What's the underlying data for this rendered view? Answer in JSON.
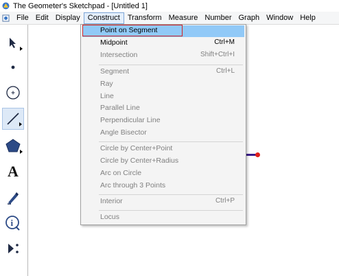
{
  "window": {
    "title": "The Geometer's Sketchpad - [Untitled 1]"
  },
  "menubar": {
    "items": [
      "File",
      "Edit",
      "Display",
      "Construct",
      "Transform",
      "Measure",
      "Number",
      "Graph",
      "Window",
      "Help"
    ],
    "active": "Construct"
  },
  "toolbar": {
    "tools": [
      {
        "name": "arrow-tool-icon"
      },
      {
        "name": "point-tool-icon"
      },
      {
        "name": "compass-tool-icon"
      },
      {
        "name": "straightedge-tool-icon",
        "selected": true
      },
      {
        "name": "polygon-tool-icon"
      },
      {
        "name": "text-tool-icon",
        "glyph": "A"
      },
      {
        "name": "marker-tool-icon"
      },
      {
        "name": "information-tool-icon",
        "glyph": "i"
      },
      {
        "name": "custom-tool-icon"
      }
    ]
  },
  "construct_menu": {
    "items": [
      {
        "label": "Point on Segment",
        "shortcut": "",
        "enabled": true,
        "highlighted": true
      },
      {
        "label": "Midpoint",
        "shortcut": "Ctrl+M",
        "enabled": true
      },
      {
        "label": "Intersection",
        "shortcut": "Shift+Ctrl+I",
        "enabled": false
      },
      {
        "label": "Segment",
        "shortcut": "Ctrl+L",
        "enabled": false
      },
      {
        "label": "Ray",
        "shortcut": "",
        "enabled": false
      },
      {
        "label": "Line",
        "shortcut": "",
        "enabled": false
      },
      {
        "label": "Parallel Line",
        "shortcut": "",
        "enabled": false
      },
      {
        "label": "Perpendicular Line",
        "shortcut": "",
        "enabled": false
      },
      {
        "label": "Angle Bisector",
        "shortcut": "",
        "enabled": false
      },
      {
        "label": "Circle by Center+Point",
        "shortcut": "",
        "enabled": false
      },
      {
        "label": "Circle by Center+Radius",
        "shortcut": "",
        "enabled": false
      },
      {
        "label": "Arc on Circle",
        "shortcut": "",
        "enabled": false
      },
      {
        "label": "Arc through 3 Points",
        "shortcut": "",
        "enabled": false
      },
      {
        "label": "Interior",
        "shortcut": "Ctrl+P",
        "enabled": false
      },
      {
        "label": "Locus",
        "shortcut": "",
        "enabled": false
      }
    ]
  },
  "colors": {
    "highlight": "#91c9f7",
    "annotation_box": "#d52020",
    "segment": "#3a1c8c",
    "point": "#e0201c"
  }
}
